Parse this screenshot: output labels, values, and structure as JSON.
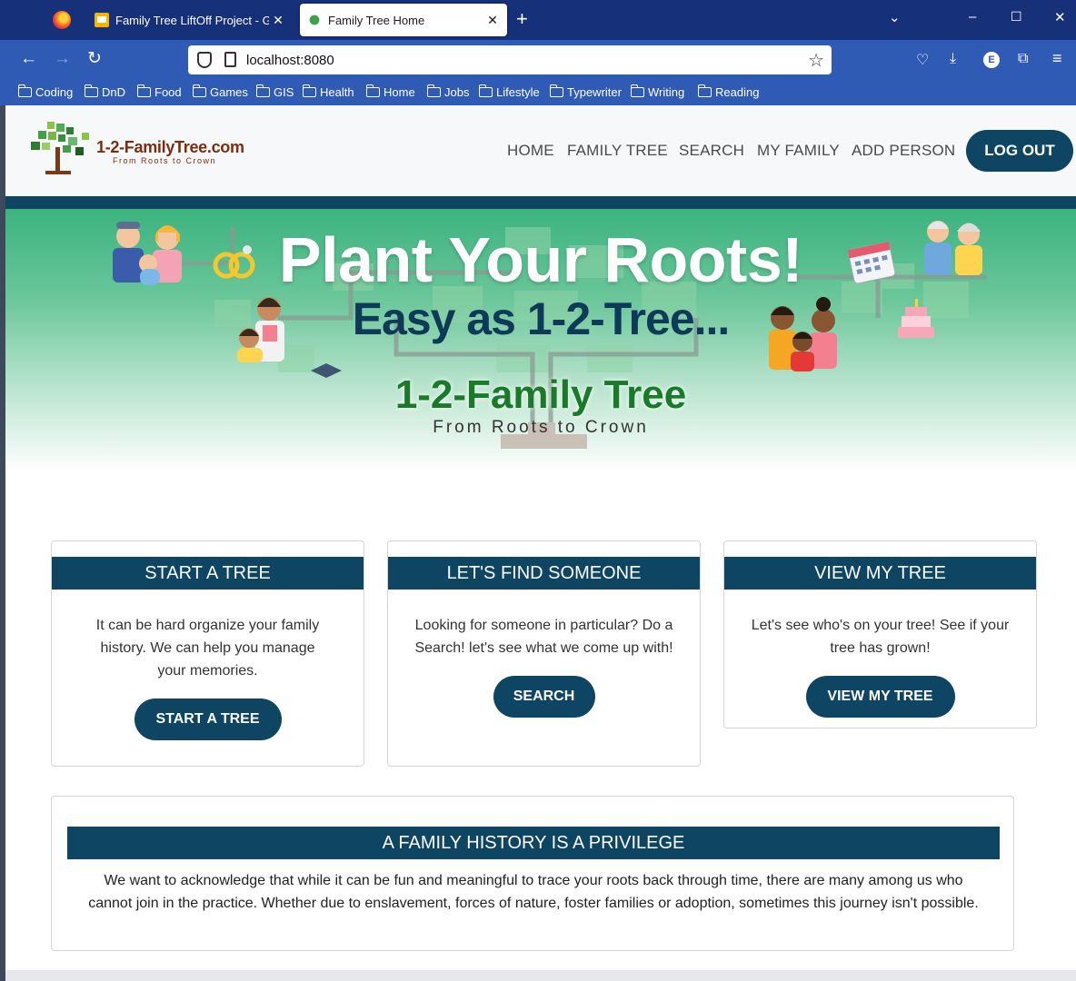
{
  "browser": {
    "tabs": [
      {
        "title": "Family Tree LiftOff Project - Goo",
        "favicon": "slides-icon",
        "active": false
      },
      {
        "title": "Family Tree Home",
        "favicon": "tree-icon",
        "active": true
      }
    ],
    "url": "localhost:8080",
    "bookmarks": [
      "Coding",
      "DnD",
      "Food",
      "Games",
      "GIS",
      "Health",
      "Home",
      "Jobs",
      "Lifestyle",
      "Typewriter",
      "Writing",
      "Reading"
    ]
  },
  "header": {
    "brand": "1-2-FamilyTree.com",
    "tagline": "From Roots to Crown",
    "nav": [
      "HOME",
      "FAMILY TREE",
      "SEARCH",
      "MY FAMILY",
      "ADD PERSON"
    ],
    "logout": "LOG OUT"
  },
  "hero": {
    "title": "Plant Your Roots!",
    "subtitle": "Easy as 1-2-Tree...",
    "brand": "1-2-Family Tree",
    "tagline": "From Roots to Crown"
  },
  "cards": [
    {
      "heading": "START A TREE",
      "text": "It can be hard organize your family history. We can help you manage your memories.",
      "button": "START A TREE"
    },
    {
      "heading": "LET'S FIND SOMEONE",
      "text": "Looking for someone in particular? Do a Search! let's see what we come up with!",
      "button": "SEARCH"
    },
    {
      "heading": "VIEW MY TREE",
      "text": "Let's see who's on your tree! See if your tree has grown!",
      "button": "VIEW MY TREE"
    }
  ],
  "privilege": {
    "heading": "A FAMILY HISTORY IS A PRIVILEGE",
    "text": "We want to acknowledge that while it can be fun and meaningful to trace your roots back through time, there are many among us who cannot join in the practice. Whether due to enslavement, forces of nature, foster families or adoption, sometimes this journey isn't possible."
  },
  "colors": {
    "brand_dark": "#0d4562",
    "hero_green": "#3cb37f",
    "browser_blue": "#2f5bb5"
  }
}
